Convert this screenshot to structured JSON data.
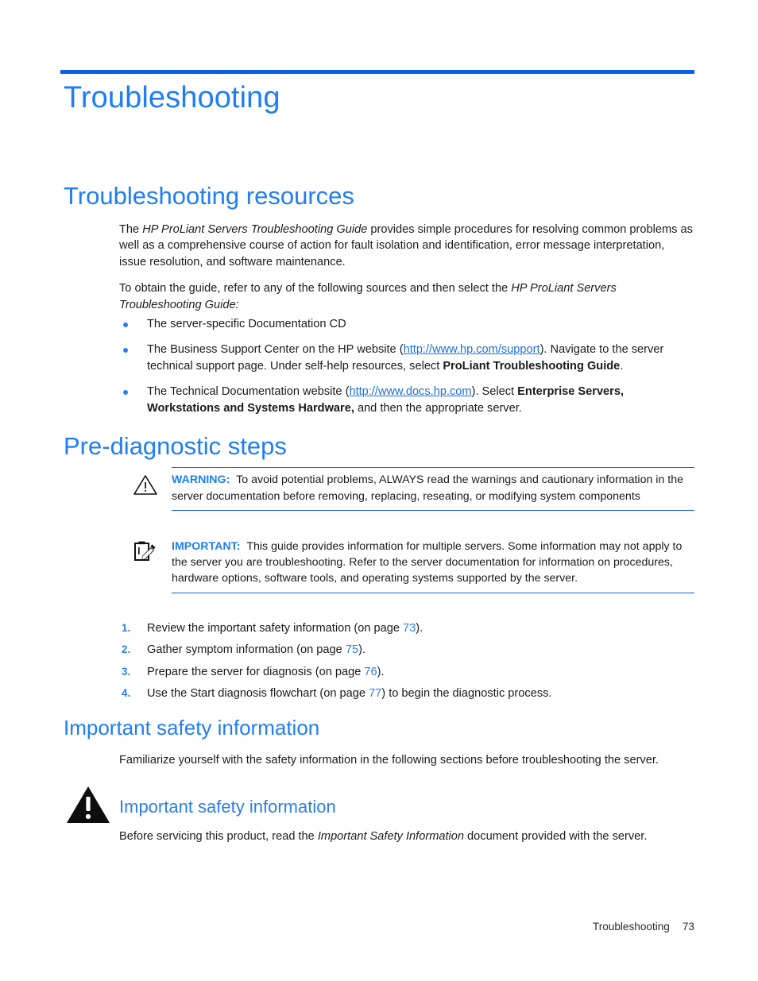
{
  "chapter": {
    "title": "Troubleshooting"
  },
  "sections": {
    "resources": {
      "heading": "Troubleshooting resources",
      "para1_pre": "The ",
      "para1_em": "HP ProLiant Servers Troubleshooting Guide",
      "para1_post": " provides simple procedures for resolving common problems as well as a comprehensive course of action for fault isolation and identification, error message interpretation, issue resolution, and software maintenance.",
      "para2_pre": "To obtain the guide, refer to any of the following sources and then select the ",
      "para2_em": "HP ProLiant Servers Troubleshooting Guide:",
      "bullets": [
        {
          "text": "The server-specific Documentation CD"
        },
        {
          "pre": "The Business Support Center on the HP website (",
          "link": "http://www.hp.com/support",
          "mid": "). Navigate to the server technical support page. Under self-help resources, select ",
          "bold": "ProLiant Troubleshooting Guide",
          "post": "."
        },
        {
          "pre": "The Technical Documentation website (",
          "link": "http://www.docs.hp.com",
          "mid": "). Select ",
          "bold": "Enterprise Servers, Workstations and Systems Hardware,",
          "post": " and then the appropriate server."
        }
      ]
    },
    "prediagnostic": {
      "heading": "Pre-diagnostic steps",
      "warning_note": {
        "icon": "warning-triangle-icon",
        "label": "WARNING:",
        "text": "To avoid potential problems, ALWAYS read the warnings and cautionary information in the server documentation before removing, replacing, reseating, or modifying system components"
      },
      "important_note": {
        "icon": "clipboard-pencil-icon",
        "label": "IMPORTANT:",
        "text": "This guide provides information for multiple servers. Some information may not apply to the server you are troubleshooting. Refer to the server documentation for information on procedures, hardware options, software tools, and operating systems supported by the server."
      },
      "steps": [
        {
          "marker": "1.",
          "pre": "Review the important safety information (on page ",
          "page": "73",
          "post": ")."
        },
        {
          "marker": "2.",
          "pre": "Gather symptom information (on page ",
          "page": "75",
          "post": ")."
        },
        {
          "marker": "3.",
          "pre": "Prepare the server for diagnosis (on page ",
          "page": "76",
          "post": ")."
        },
        {
          "marker": "4.",
          "pre": "Use the Start diagnosis flowchart (on page ",
          "page": "77",
          "post": ") to begin the diagnostic process."
        }
      ]
    },
    "safety": {
      "heading": "Important safety information",
      "intro": "Familiarize yourself with the safety information in the following sections before troubleshooting the server.",
      "banner": {
        "icon": "solid-warning-triangle-icon",
        "title": "Important safety information"
      },
      "outro_pre": "Before servicing this product, read the ",
      "outro_em": "Important Safety Information",
      "outro_post": " document provided with the server."
    }
  },
  "footer": {
    "label": "Troubleshooting",
    "page": "73"
  },
  "colors": {
    "accent_blue": "#1e7ef5",
    "rule_blue": "#0a5ff0",
    "link_blue": "#1e6fd9"
  }
}
